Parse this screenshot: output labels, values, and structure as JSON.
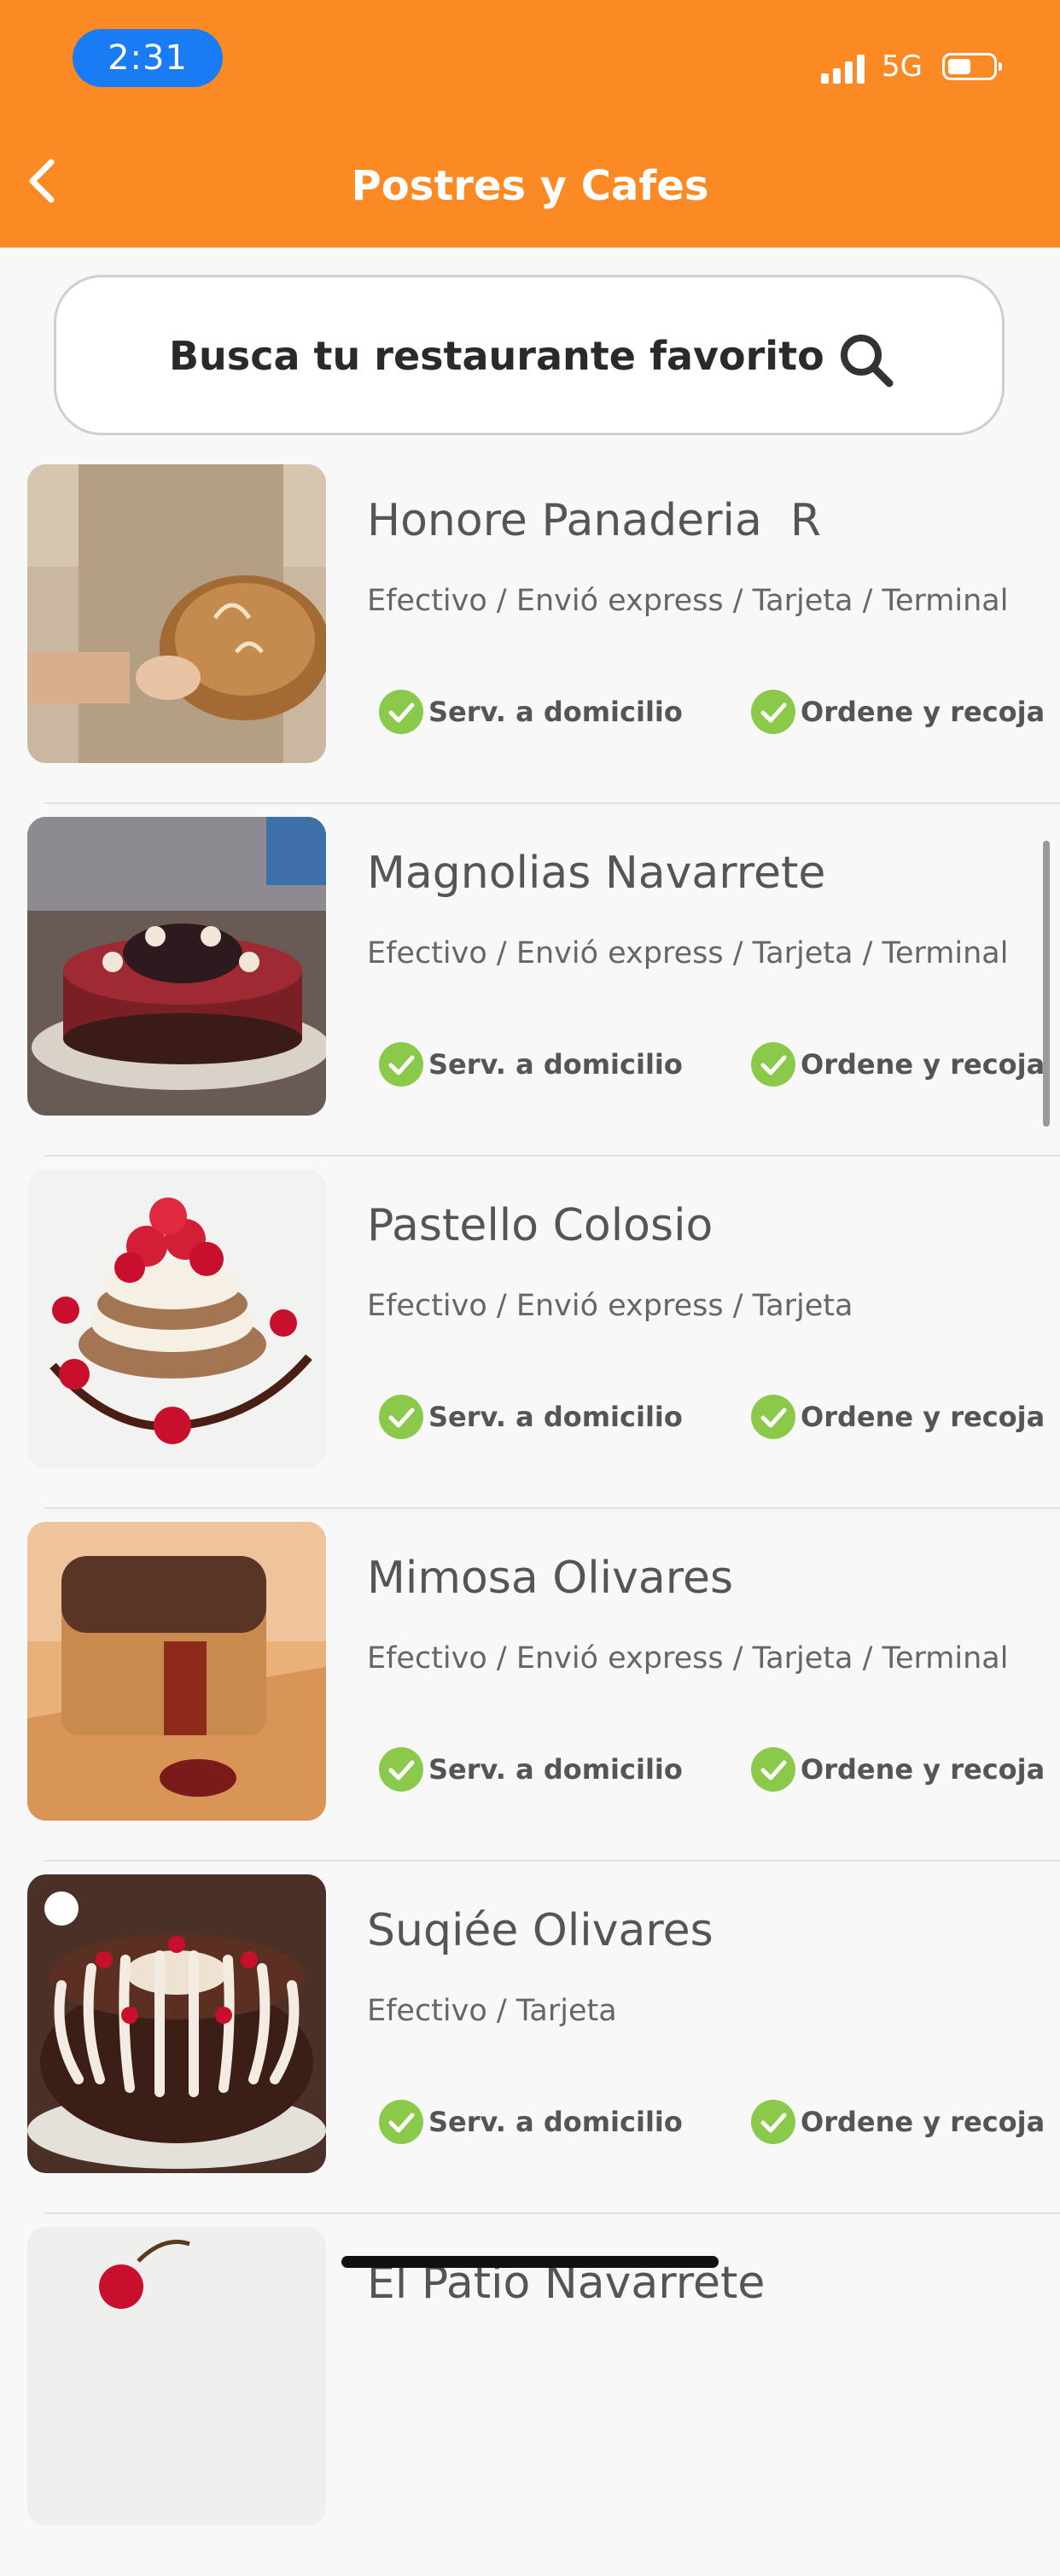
{
  "status_bar": {
    "time": "2:31",
    "network": "5G"
  },
  "nav": {
    "title": "Postres y Cafes"
  },
  "search": {
    "placeholder": "Busca tu restaurante favorito"
  },
  "restaurants": [
    {
      "name": "Honore Panaderia  R",
      "payment": "Efectivo / Envió express / Tarjeta / Terminal",
      "features": [
        "Serv. a domicilio",
        "Ordene y recoja"
      ]
    },
    {
      "name": "Magnolias Navarrete",
      "payment": "Efectivo / Envió express / Tarjeta / Terminal",
      "features": [
        "Serv. a domicilio",
        "Ordene y recoja"
      ]
    },
    {
      "name": "Pastello Colosio",
      "payment": "Efectivo / Envió express / Tarjeta",
      "features": [
        "Serv. a domicilio",
        "Ordene y recoja"
      ]
    },
    {
      "name": "Mimosa Olivares",
      "payment": "Efectivo / Envió express / Tarjeta / Terminal",
      "features": [
        "Serv. a domicilio",
        "Ordene y recoja"
      ]
    },
    {
      "name": "Suqiée Olivares",
      "payment": "Efectivo / Tarjeta",
      "features": [
        "Serv. a domicilio",
        "Ordene y recoja"
      ]
    },
    {
      "name": "El Patio Navarrete",
      "payment": "",
      "features": []
    }
  ],
  "colors": {
    "header": "#fb8a25",
    "check": "#8bc94a",
    "time_pill": "#1a7cf5"
  },
  "icons": {
    "back": "chevron-left-icon",
    "search": "magnifier-icon",
    "check": "check-circle-icon"
  }
}
